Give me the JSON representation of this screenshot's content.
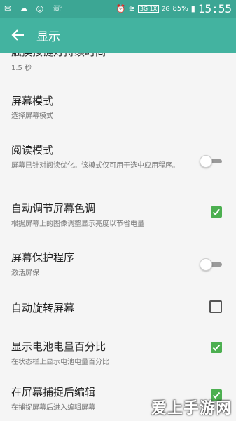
{
  "statusbar": {
    "icons": "✉ ☁ ◎ ☏",
    "network": "3G 1X",
    "network2": "2G",
    "battery": "85%",
    "time": "15:55"
  },
  "appbar": {
    "title": "显示"
  },
  "rows": [
    {
      "title": "触摸按键灯持续时间",
      "subtitle": "1.5 秒"
    },
    {
      "title": "屏幕模式",
      "subtitle": "选择屏幕模式"
    },
    {
      "title": "阅读模式",
      "subtitle": "屏幕已针对阅读优化。该模式仅可用于选中应用程序。",
      "toggle": false
    },
    {
      "title": "自动调节屏幕色调",
      "subtitle": "根据屏幕上的图像调整显示亮度以节省电量",
      "checked": true
    },
    {
      "title": "屏幕保护程序",
      "subtitle": "激活屏保",
      "toggle": false
    },
    {
      "title": "自动旋转屏幕",
      "checked": false
    },
    {
      "title": "显示电池电量百分比",
      "subtitle": "在状态栏上显示电池电量百分比",
      "checked": true
    },
    {
      "title": "在屏幕捕捉后编辑",
      "subtitle": "在捕捉屏幕后进入编辑屏幕",
      "checked": true
    }
  ],
  "watermark": "爱上手游网",
  "colors": {
    "statusbar": "#3ca694",
    "appbar": "#43b3a0",
    "check": "#4caf50"
  }
}
